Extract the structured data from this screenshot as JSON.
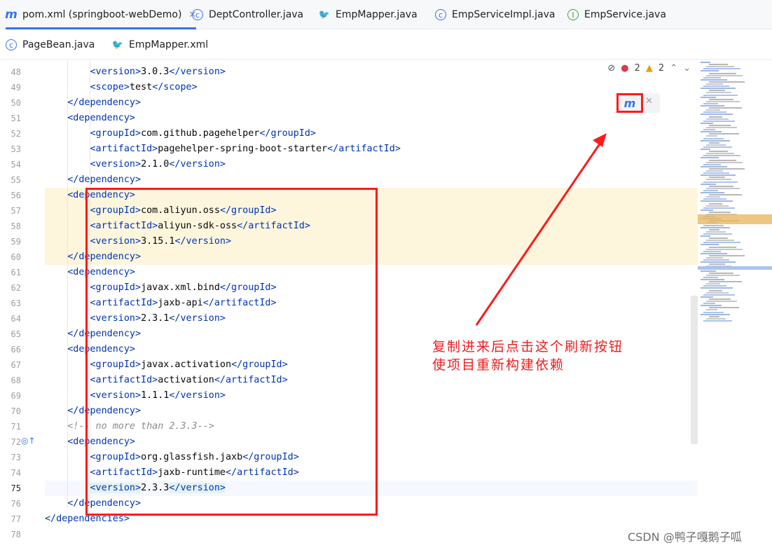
{
  "tabs_row1": [
    {
      "label": "pom.xml (springboot-webDemo)",
      "icon": "maven-icon",
      "active": true,
      "closable": true
    },
    {
      "label": "DeptController.java",
      "icon": "class-icon"
    },
    {
      "label": "EmpMapper.java",
      "icon": "mybatis-bird-icon"
    },
    {
      "label": "EmpServiceImpl.java",
      "icon": "class-icon"
    },
    {
      "label": "EmpService.java",
      "icon": "interface-icon"
    }
  ],
  "tabs_row2": [
    {
      "label": "PageBean.java",
      "icon": "class-icon"
    },
    {
      "label": "EmpMapper.xml",
      "icon": "mybatis-bird-icon"
    }
  ],
  "inspection": {
    "errors": "2",
    "warnings": "2"
  },
  "maven_refresh_label": "m",
  "lines": [
    {
      "n": "48",
      "indent": "        ",
      "parts": [
        {
          "t": "<version>",
          "c": "tag"
        },
        {
          "t": "3.0.3"
        },
        {
          "t": "</version>",
          "c": "tag"
        }
      ]
    },
    {
      "n": "49",
      "indent": "        ",
      "parts": [
        {
          "t": "<scope>",
          "c": "tag"
        },
        {
          "t": "test"
        },
        {
          "t": "</scope>",
          "c": "tag"
        }
      ]
    },
    {
      "n": "50",
      "indent": "    ",
      "parts": [
        {
          "t": "</dependency>",
          "c": "tag"
        }
      ]
    },
    {
      "n": "51",
      "indent": "    ",
      "parts": [
        {
          "t": "<dependency>",
          "c": "tag"
        }
      ]
    },
    {
      "n": "52",
      "indent": "        ",
      "parts": [
        {
          "t": "<groupId>",
          "c": "tag"
        },
        {
          "t": "com.github.pagehelper"
        },
        {
          "t": "</groupId>",
          "c": "tag"
        }
      ]
    },
    {
      "n": "53",
      "indent": "        ",
      "parts": [
        {
          "t": "<artifactId>",
          "c": "tag"
        },
        {
          "t": "pagehelper-spring-boot-starter"
        },
        {
          "t": "</artifactId>",
          "c": "tag"
        }
      ]
    },
    {
      "n": "54",
      "indent": "        ",
      "parts": [
        {
          "t": "<version>",
          "c": "tag"
        },
        {
          "t": "2.1.0"
        },
        {
          "t": "</version>",
          "c": "tag"
        }
      ]
    },
    {
      "n": "55",
      "indent": "    ",
      "parts": [
        {
          "t": "</dependency>",
          "c": "tag"
        }
      ]
    },
    {
      "n": "56",
      "indent": "    ",
      "parts": [
        {
          "t": "<dependency>",
          "c": "tag"
        }
      ]
    },
    {
      "n": "57",
      "indent": "        ",
      "parts": [
        {
          "t": "<groupId>",
          "c": "tag"
        },
        {
          "t": "com.aliyun.oss"
        },
        {
          "t": "</groupId>",
          "c": "tag"
        }
      ]
    },
    {
      "n": "58",
      "indent": "        ",
      "parts": [
        {
          "t": "<artifactId>",
          "c": "tag"
        },
        {
          "t": "aliyun-sdk-oss"
        },
        {
          "t": "</artifactId>",
          "c": "tag"
        }
      ]
    },
    {
      "n": "59",
      "indent": "        ",
      "parts": [
        {
          "t": "<version>",
          "c": "tag"
        },
        {
          "t": "3.15.1"
        },
        {
          "t": "</version>",
          "c": "tag"
        }
      ]
    },
    {
      "n": "60",
      "indent": "    ",
      "parts": [
        {
          "t": "</dependency>",
          "c": "tag"
        }
      ]
    },
    {
      "n": "61",
      "indent": "    ",
      "parts": [
        {
          "t": "<dependency>",
          "c": "tag"
        }
      ]
    },
    {
      "n": "62",
      "indent": "        ",
      "parts": [
        {
          "t": "<groupId>",
          "c": "tag"
        },
        {
          "t": "javax.xml.bind"
        },
        {
          "t": "</groupId>",
          "c": "tag"
        }
      ]
    },
    {
      "n": "63",
      "indent": "        ",
      "parts": [
        {
          "t": "<artifactId>",
          "c": "tag"
        },
        {
          "t": "jaxb-api"
        },
        {
          "t": "</artifactId>",
          "c": "tag"
        }
      ]
    },
    {
      "n": "64",
      "indent": "        ",
      "parts": [
        {
          "t": "<version>",
          "c": "tag"
        },
        {
          "t": "2.3.1"
        },
        {
          "t": "</version>",
          "c": "tag"
        }
      ]
    },
    {
      "n": "65",
      "indent": "    ",
      "parts": [
        {
          "t": "</dependency>",
          "c": "tag"
        }
      ]
    },
    {
      "n": "66",
      "indent": "    ",
      "parts": [
        {
          "t": "<dependency>",
          "c": "tag"
        }
      ]
    },
    {
      "n": "67",
      "indent": "        ",
      "parts": [
        {
          "t": "<groupId>",
          "c": "tag"
        },
        {
          "t": "javax.activation"
        },
        {
          "t": "</groupId>",
          "c": "tag"
        }
      ]
    },
    {
      "n": "68",
      "indent": "        ",
      "parts": [
        {
          "t": "<artifactId>",
          "c": "tag"
        },
        {
          "t": "activation"
        },
        {
          "t": "</artifactId>",
          "c": "tag"
        }
      ]
    },
    {
      "n": "69",
      "indent": "        ",
      "parts": [
        {
          "t": "<version>",
          "c": "tag"
        },
        {
          "t": "1.1.1"
        },
        {
          "t": "</version>",
          "c": "tag"
        }
      ]
    },
    {
      "n": "70",
      "indent": "    ",
      "parts": [
        {
          "t": "</dependency>",
          "c": "tag"
        }
      ]
    },
    {
      "n": "71",
      "indent": "    ",
      "parts": [
        {
          "t": "<!-- no more than 2.3.3-->",
          "c": "cmt"
        }
      ]
    },
    {
      "n": "72",
      "indent": "    ",
      "parts": [
        {
          "t": "<dependency>",
          "c": "tag"
        }
      ]
    },
    {
      "n": "73",
      "indent": "        ",
      "parts": [
        {
          "t": "<groupId>",
          "c": "tag"
        },
        {
          "t": "org.glassfish.jaxb"
        },
        {
          "t": "</groupId>",
          "c": "tag"
        }
      ]
    },
    {
      "n": "74",
      "indent": "        ",
      "parts": [
        {
          "t": "<artifactId>",
          "c": "tag"
        },
        {
          "t": "jaxb-runtime"
        },
        {
          "t": "</artifactId>",
          "c": "tag"
        }
      ]
    },
    {
      "n": "75",
      "indent": "        ",
      "parts": [
        {
          "t": "<version>",
          "c": "tagbox"
        },
        {
          "t": "2.3.3"
        },
        {
          "t": "</version>",
          "c": "tagbox"
        }
      ]
    },
    {
      "n": "76",
      "indent": "    ",
      "parts": [
        {
          "t": "</dependency>",
          "c": "tag"
        }
      ]
    },
    {
      "n": "77",
      "indent": "",
      "parts": [
        {
          "t": "</dependencies>",
          "c": "tag"
        }
      ]
    },
    {
      "n": "78",
      "indent": "",
      "parts": []
    }
  ],
  "annotation": {
    "line1": "复制进来后点击这个刷新按钮",
    "line2": "使项目重新构建依赖"
  },
  "watermark": "CSDN @鸭子嘎鹅子呱",
  "colors": {
    "accent": "#3574f0",
    "annotation_red": "#ff1a1a",
    "tag": "#0033b3"
  }
}
